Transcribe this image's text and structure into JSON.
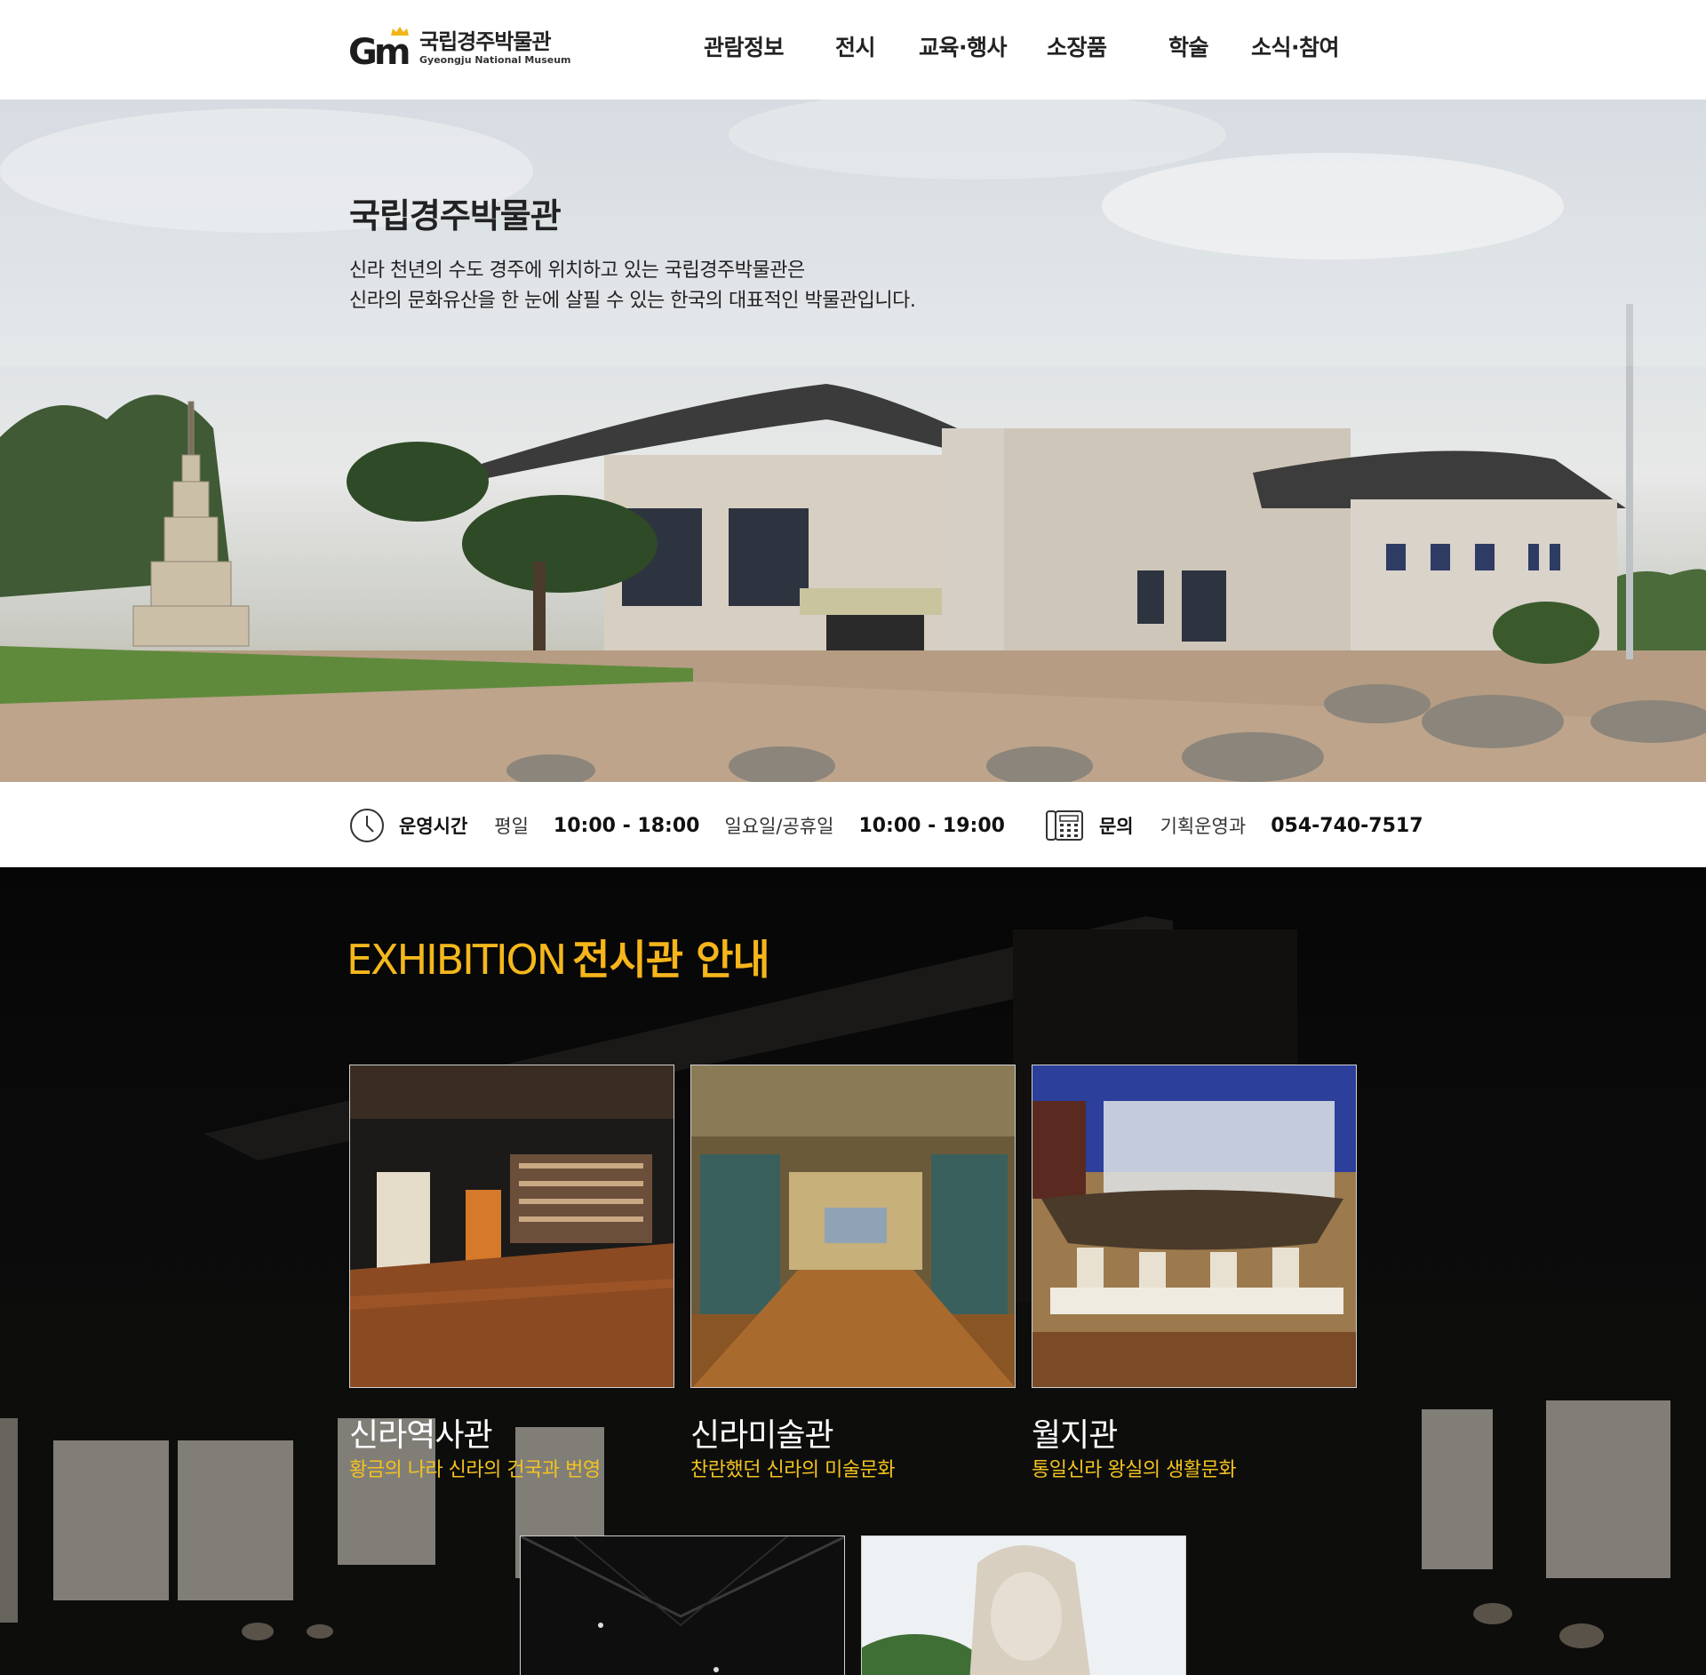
{
  "header": {
    "logo_mark": "Gm",
    "logo_name": "국립경주박물관",
    "logo_name_en": "Gyeongju National Museum",
    "nav": [
      "관람정보",
      "전시",
      "교육·행사",
      "소장품",
      "학술",
      "소식·참여"
    ]
  },
  "hero": {
    "title": "국립경주박물관",
    "desc_line1": "신라 천년의 수도 경주에 위치하고 있는 국립경주박물관은",
    "desc_line2": "신라의 문화유산을 한 눈에 살필 수 있는 한국의 대표적인 박물관입니다."
  },
  "info": {
    "hours_label": "운영시간",
    "weekday_label": "평일",
    "weekday_hours": "10:00 - 18:00",
    "holiday_label": "일요일/공휴일",
    "holiday_hours": "10:00 - 19:00",
    "contact_label": "문의",
    "contact_dept": "기획운영과",
    "contact_phone": "054-740-7517",
    "icons": [
      "clock-icon",
      "phone-icon"
    ]
  },
  "exhibition": {
    "title_en": "EXHIBITION",
    "title_ko": "전시관 안내",
    "accent_color": "#f4b81c",
    "halls": [
      {
        "name": "신라역사관",
        "desc": "황금의 나라 신라의 건국과 번영"
      },
      {
        "name": "신라미술관",
        "desc": "찬란했던 신라의 미술문화"
      },
      {
        "name": "월지관",
        "desc": "통일신라 왕실의 생활문화"
      }
    ]
  }
}
